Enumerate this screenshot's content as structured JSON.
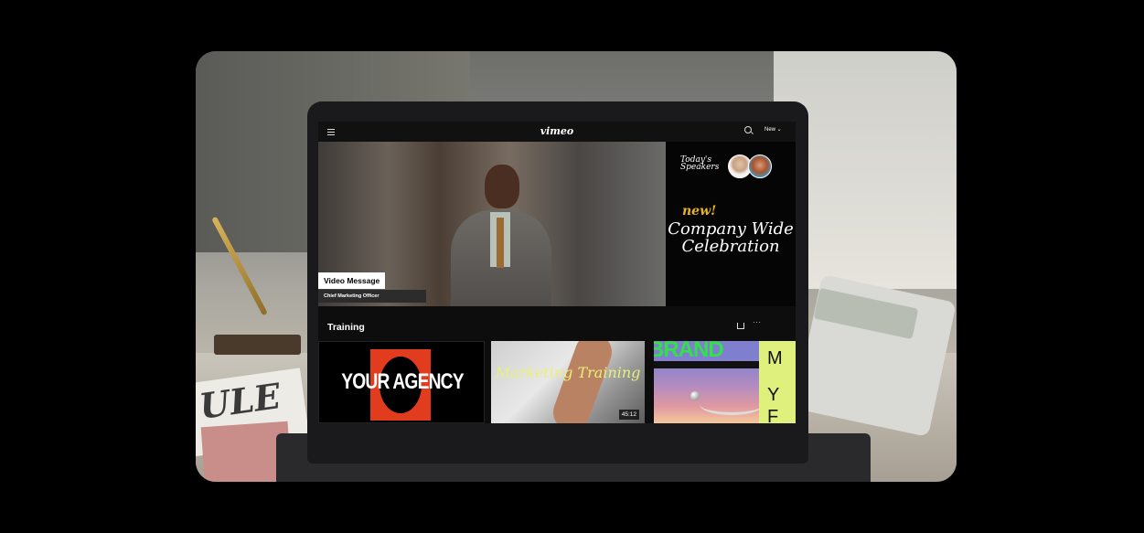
{
  "app": {
    "logo": "vimeo",
    "new_button": "New ⌄"
  },
  "hero": {
    "title": "Video Message",
    "subtitle": "Chief Marketing Officer"
  },
  "promo": {
    "speakers_label": "Today's Speakers",
    "new_tag": "new!",
    "headline": "Company Wide Celebration"
  },
  "training": {
    "title": "Training",
    "more": "···",
    "videos": [
      {
        "title": "YOUR AGENCY"
      },
      {
        "title": "Marketing Training",
        "duration": "45:12"
      },
      {
        "title": "BRAND",
        "side_letters": [
          "M",
          "Y",
          "F"
        ]
      }
    ]
  },
  "scene": {
    "paper_text": "ULE"
  }
}
